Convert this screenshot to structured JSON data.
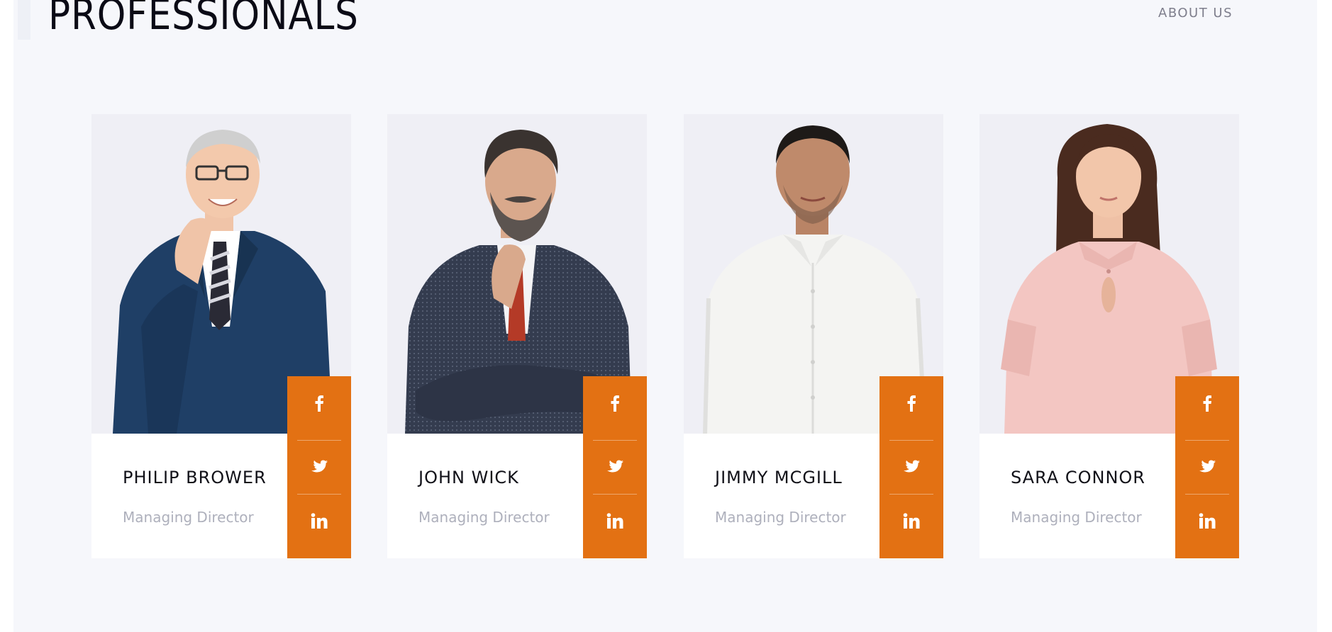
{
  "header": {
    "title": "PROFESSIONALS",
    "nav_link": "ABOUT US"
  },
  "accent_color": "#e37113",
  "team": [
    {
      "name": "PHILIP BROWER",
      "role": "Managing Director",
      "photo": "portrait-man-navy-suit-glasses"
    },
    {
      "name": "JOHN WICK",
      "role": "Managing Director",
      "photo": "portrait-man-tweed-jacket-beard"
    },
    {
      "name": "JIMMY MCGILL",
      "role": "Managing Director",
      "photo": "portrait-man-white-shirt"
    },
    {
      "name": "SARA CONNOR",
      "role": "Managing Director",
      "photo": "portrait-woman-pink-blouse"
    }
  ],
  "social_icons": [
    "facebook-icon",
    "twitter-icon",
    "linkedin-icon"
  ]
}
